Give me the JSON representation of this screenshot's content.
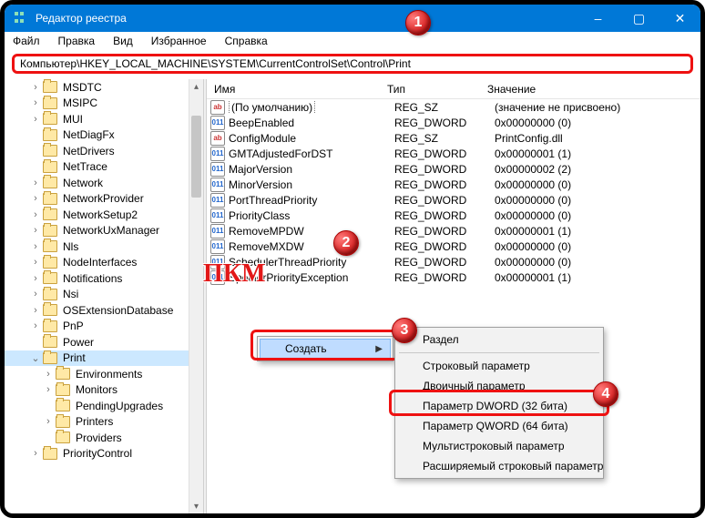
{
  "window": {
    "title": "Редактор реестра",
    "minimize": "–",
    "maximize": "▢",
    "close": "✕"
  },
  "menu": {
    "file": "Файл",
    "edit": "Правка",
    "view": "Вид",
    "favorites": "Избранное",
    "help": "Справка"
  },
  "address": {
    "path": "Компьютер\\HKEY_LOCAL_MACHINE\\SYSTEM\\CurrentControlSet\\Control\\Print"
  },
  "tree": {
    "items": [
      {
        "exp": ">",
        "label": "MSDTC",
        "ind": 0
      },
      {
        "exp": ">",
        "label": "MSIPC",
        "ind": 0
      },
      {
        "exp": ">",
        "label": "MUI",
        "ind": 0
      },
      {
        "exp": "",
        "label": "NetDiagFx",
        "ind": 0
      },
      {
        "exp": "",
        "label": "NetDrivers",
        "ind": 0
      },
      {
        "exp": "",
        "label": "NetTrace",
        "ind": 0
      },
      {
        "exp": ">",
        "label": "Network",
        "ind": 0
      },
      {
        "exp": ">",
        "label": "NetworkProvider",
        "ind": 0
      },
      {
        "exp": ">",
        "label": "NetworkSetup2",
        "ind": 0
      },
      {
        "exp": ">",
        "label": "NetworkUxManager",
        "ind": 0
      },
      {
        "exp": ">",
        "label": "Nls",
        "ind": 0
      },
      {
        "exp": ">",
        "label": "NodeInterfaces",
        "ind": 0
      },
      {
        "exp": ">",
        "label": "Notifications",
        "ind": 0
      },
      {
        "exp": ">",
        "label": "Nsi",
        "ind": 0
      },
      {
        "exp": ">",
        "label": "OSExtensionDatabase",
        "ind": 0
      },
      {
        "exp": ">",
        "label": "PnP",
        "ind": 0
      },
      {
        "exp": "",
        "label": "Power",
        "ind": 0
      },
      {
        "exp": "v",
        "label": "Print",
        "ind": 0,
        "sel": true
      },
      {
        "exp": ">",
        "label": "Environments",
        "ind": 1
      },
      {
        "exp": ">",
        "label": "Monitors",
        "ind": 1
      },
      {
        "exp": "",
        "label": "PendingUpgrades",
        "ind": 1
      },
      {
        "exp": ">",
        "label": "Printers",
        "ind": 1
      },
      {
        "exp": "",
        "label": "Providers",
        "ind": 1
      },
      {
        "exp": ">",
        "label": "PriorityControl",
        "ind": 0
      }
    ]
  },
  "list": {
    "headers": {
      "name": "Имя",
      "type": "Тип",
      "value": "Значение"
    },
    "rows": [
      {
        "icon": "sz",
        "name": "(По умолчанию)",
        "type": "REG_SZ",
        "value": "(значение не присвоено)",
        "dotted": true
      },
      {
        "icon": "bin",
        "name": "BeepEnabled",
        "type": "REG_DWORD",
        "value": "0x00000000 (0)"
      },
      {
        "icon": "sz",
        "name": "ConfigModule",
        "type": "REG_SZ",
        "value": "PrintConfig.dll"
      },
      {
        "icon": "bin",
        "name": "GMTAdjustedForDST",
        "type": "REG_DWORD",
        "value": "0x00000001 (1)"
      },
      {
        "icon": "bin",
        "name": "MajorVersion",
        "type": "REG_DWORD",
        "value": "0x00000002 (2)"
      },
      {
        "icon": "bin",
        "name": "MinorVersion",
        "type": "REG_DWORD",
        "value": "0x00000000 (0)"
      },
      {
        "icon": "bin",
        "name": "PortThreadPriority",
        "type": "REG_DWORD",
        "value": "0x00000000 (0)"
      },
      {
        "icon": "bin",
        "name": "PriorityClass",
        "type": "REG_DWORD",
        "value": "0x00000000 (0)"
      },
      {
        "icon": "bin",
        "name": "RemoveMPDW",
        "type": "REG_DWORD",
        "value": "0x00000001 (1)"
      },
      {
        "icon": "bin",
        "name": "RemoveMXDW",
        "type": "REG_DWORD",
        "value": "0x00000000 (0)"
      },
      {
        "icon": "bin",
        "name": "SchedulerThreadPriority",
        "type": "REG_DWORD",
        "value": "0x00000000 (0)"
      },
      {
        "icon": "bin",
        "name": "SpoolerPriorityException",
        "type": "REG_DWORD",
        "value": "0x00000001 (1)"
      }
    ]
  },
  "ctx": {
    "create": "Создать",
    "sub": {
      "razdel": "Раздел",
      "str": "Строковый параметр",
      "bin": "Двоичный параметр",
      "dword": "Параметр DWORD (32 бита)",
      "qword": "Параметр QWORD (64 бита)",
      "multi": "Мультистроковый параметр",
      "expand": "Расширяемый строковый параметр"
    }
  },
  "annotations": {
    "pkm": "ПКМ",
    "b1": "1",
    "b2": "2",
    "b3": "3",
    "b4": "4"
  }
}
